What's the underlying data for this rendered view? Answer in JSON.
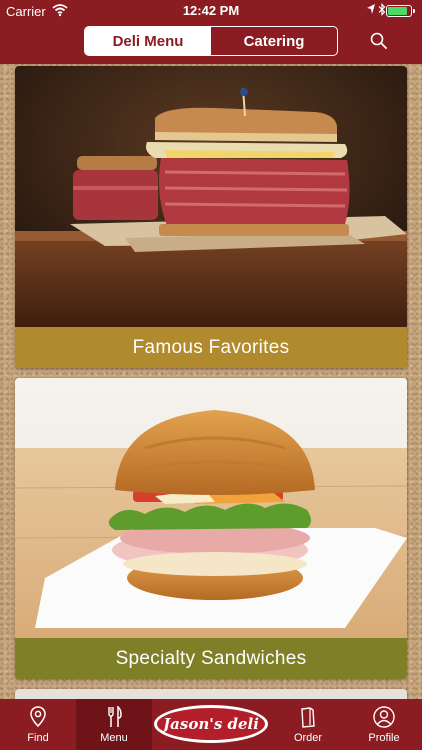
{
  "status_bar": {
    "carrier": "Carrier",
    "time": "12:42 PM",
    "icons": [
      "wifi-icon",
      "location-arrow-icon",
      "bluetooth-icon",
      "battery-icon"
    ],
    "battery_level": 0.85
  },
  "header": {
    "segments": [
      {
        "label": "Deli Menu",
        "active": true
      },
      {
        "label": "Catering",
        "active": false
      }
    ],
    "search_icon": "search-icon",
    "bar_color": "#8a1c22"
  },
  "cards": [
    {
      "title": "Famous Favorites",
      "banner_color": "#b08a2c",
      "image": "reuben-sandwich-photo"
    },
    {
      "title": "Specialty Sandwiches",
      "banner_color": "#7e7f27",
      "image": "croissant-sandwich-photo"
    }
  ],
  "tabbar": {
    "tabs": [
      {
        "label": "Find",
        "icon": "map-pin-icon",
        "active": false
      },
      {
        "label": "Menu",
        "icon": "fork-knife-icon",
        "active": true
      },
      {
        "label": "Order",
        "icon": "bag-icon",
        "active": false
      },
      {
        "label": "Profile",
        "icon": "user-icon",
        "active": false
      }
    ],
    "logo_text": "Jason's deli"
  }
}
